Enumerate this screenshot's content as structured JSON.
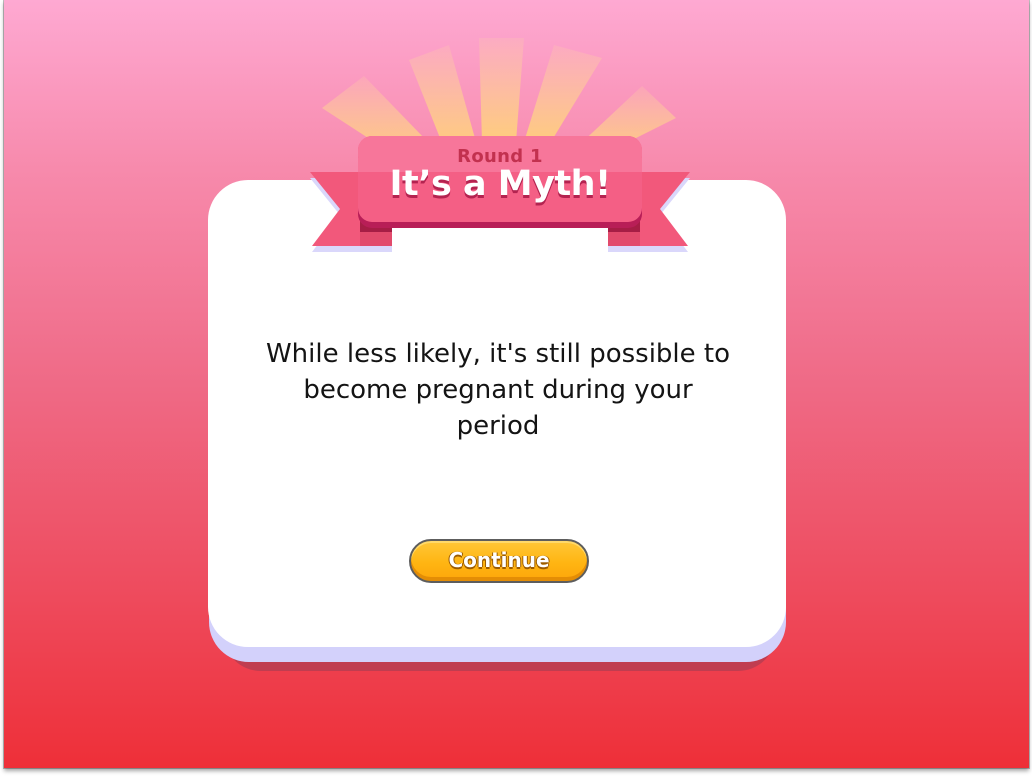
{
  "banner": {
    "round_label": "Round 1",
    "headline": "It’s a Myth!"
  },
  "card": {
    "message": "While less likely, it's still possible to become pregnant during your period"
  },
  "continue_button": {
    "label": "Continue"
  },
  "colors": {
    "background_top": "#fea9d2",
    "background_bottom": "#ee2f38",
    "banner_pink": "#f2587b",
    "button_yellow": "#ffb512"
  }
}
